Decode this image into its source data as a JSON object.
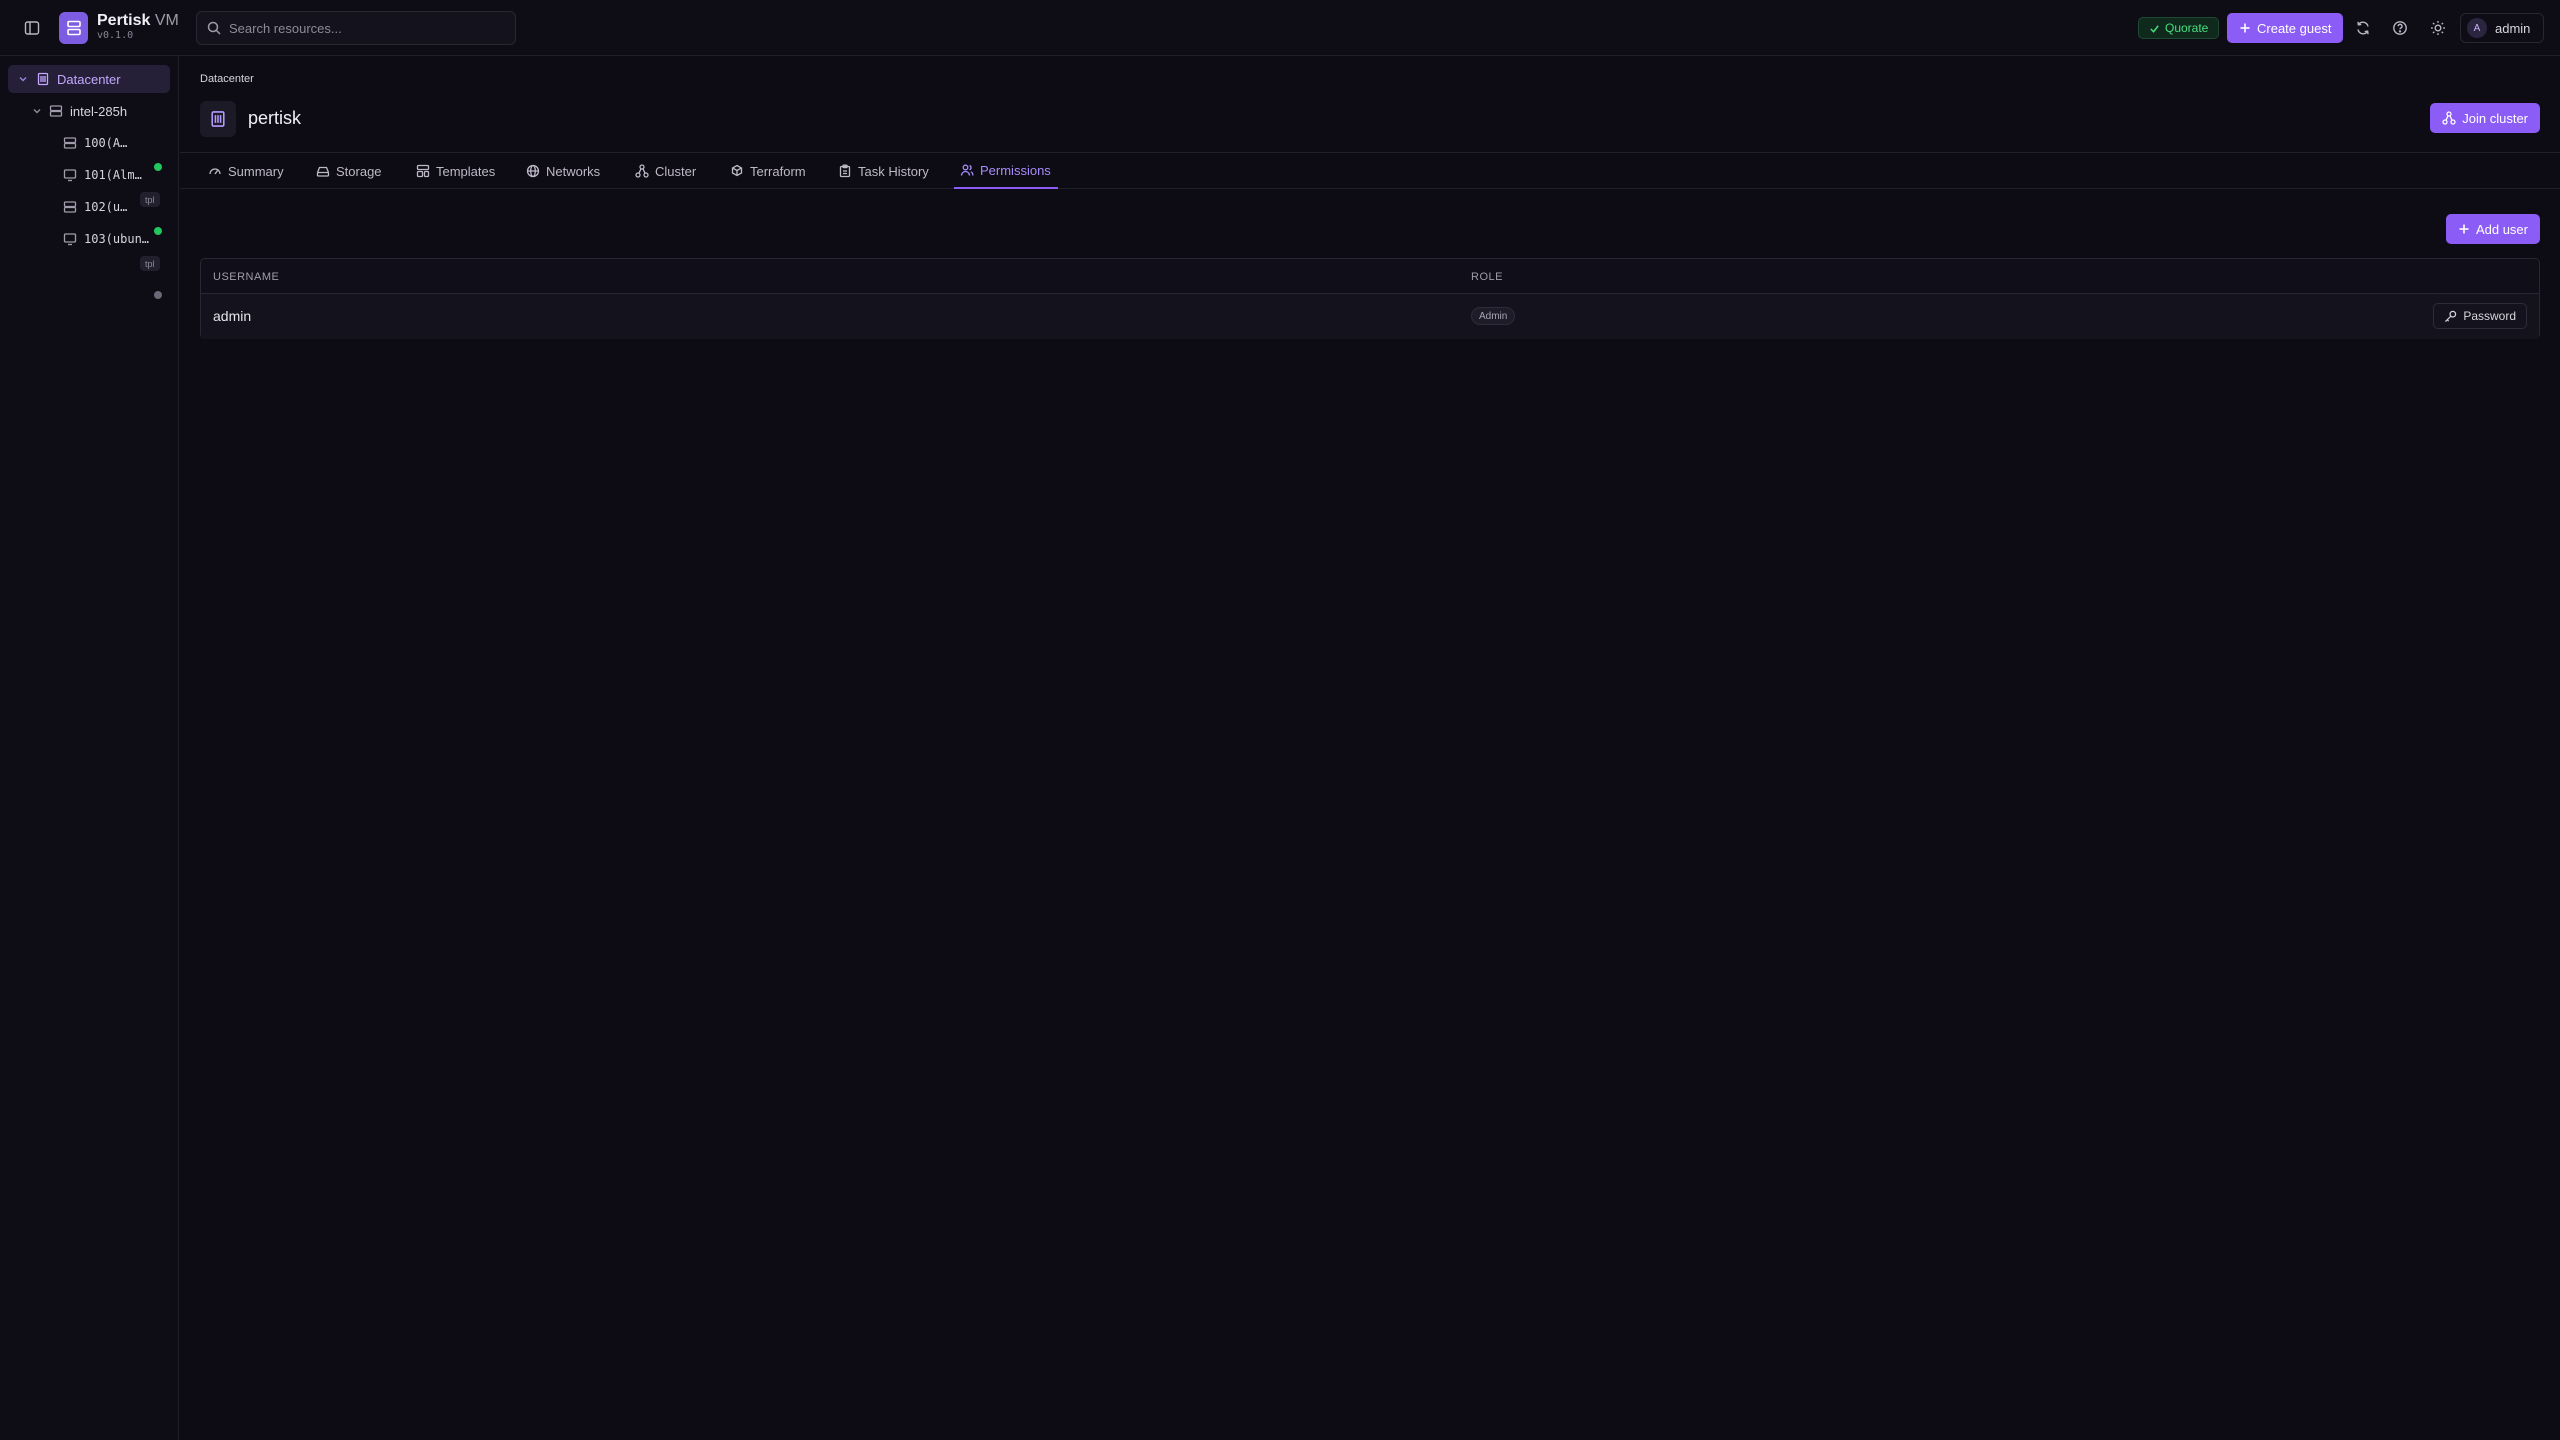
{
  "app": {
    "name": "Pertisk",
    "suffix": "VM",
    "version": "v0.1.0"
  },
  "search": {
    "placeholder": "Search resources..."
  },
  "header": {
    "quorate_label": "Quorate",
    "create_guest_label": "Create guest",
    "user": {
      "initial": "A",
      "name": "admin"
    }
  },
  "sidebar": {
    "datacenter": "Datacenter",
    "node": {
      "name": "intel-285h",
      "status_color": "#22c55e"
    },
    "guests": [
      {
        "label": "100(A…",
        "type": "template",
        "badge": "tpl"
      },
      {
        "label": "101(Alm…",
        "type": "vm",
        "status_color": "#22c55e"
      },
      {
        "label": "102(u…",
        "type": "template",
        "badge": "tpl"
      },
      {
        "label": "103(ubun…",
        "type": "vm",
        "status_color": "#6b6877"
      }
    ]
  },
  "page": {
    "breadcrumb": "Datacenter",
    "title": "pertisk",
    "join_cluster_label": "Join cluster",
    "tabs": [
      {
        "label": "Summary",
        "icon": "gauge-icon"
      },
      {
        "label": "Storage",
        "icon": "hard-drive-icon"
      },
      {
        "label": "Templates",
        "icon": "template-icon"
      },
      {
        "label": "Networks",
        "icon": "globe-icon"
      },
      {
        "label": "Cluster",
        "icon": "cluster-icon"
      },
      {
        "label": "Terraform",
        "icon": "terraform-icon"
      },
      {
        "label": "Task History",
        "icon": "clipboard-icon"
      },
      {
        "label": "Permissions",
        "icon": "users-icon",
        "active": true
      }
    ],
    "add_user_label": "Add user",
    "table": {
      "columns": [
        "USERNAME",
        "ROLE"
      ],
      "rows": [
        {
          "username": "admin",
          "role": "Admin",
          "action": "Password"
        }
      ]
    }
  },
  "colors": {
    "accent": "#8b5cf6",
    "success": "#22c55e",
    "background": "#0d0b14"
  }
}
